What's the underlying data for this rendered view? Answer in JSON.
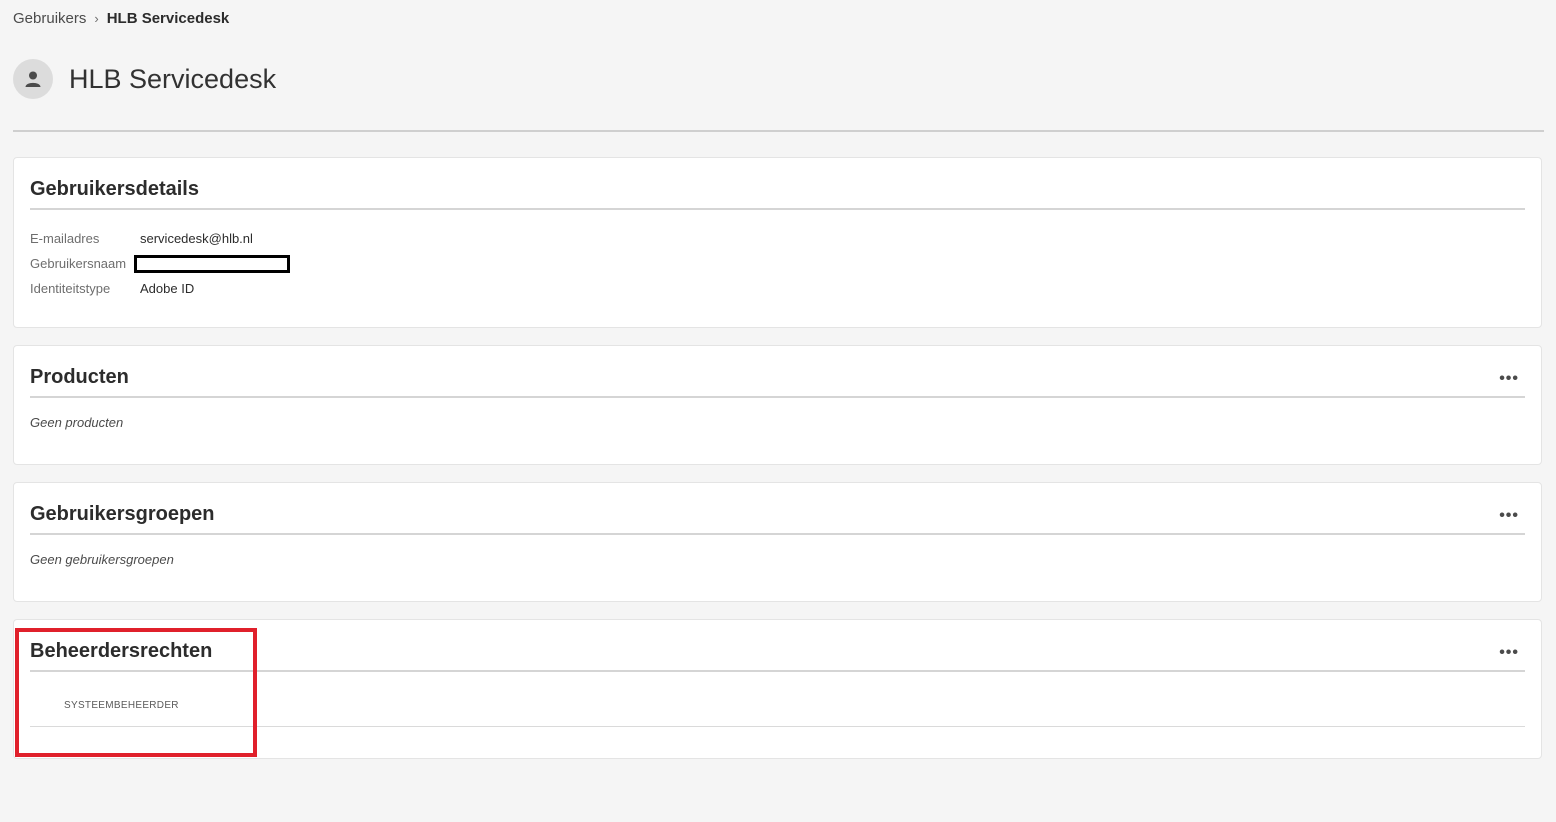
{
  "breadcrumb": {
    "parent": "Gebruikers",
    "separator": "›",
    "current": "HLB Servicedesk"
  },
  "header": {
    "title": "HLB Servicedesk",
    "avatar_icon": "user-icon"
  },
  "user_details": {
    "title": "Gebruikersdetails",
    "rows": [
      {
        "label": "E-mailadres",
        "value": "servicedesk@hlb.nl"
      },
      {
        "label": "Gebruikersnaam",
        "value": ""
      },
      {
        "label": "Identiteitstype",
        "value": "Adobe ID"
      }
    ]
  },
  "products": {
    "title": "Producten",
    "more_label": "•••",
    "empty_text": "Geen producten"
  },
  "user_groups": {
    "title": "Gebruikersgroepen",
    "more_label": "•••",
    "empty_text": "Geen gebruikersgroepen"
  },
  "admin_rights": {
    "title": "Beheerdersrechten",
    "more_label": "•••",
    "roles": [
      "SYSTEEMBEHEERDER"
    ]
  },
  "colors": {
    "highlight": "#e0202b",
    "background": "#f5f5f5"
  }
}
